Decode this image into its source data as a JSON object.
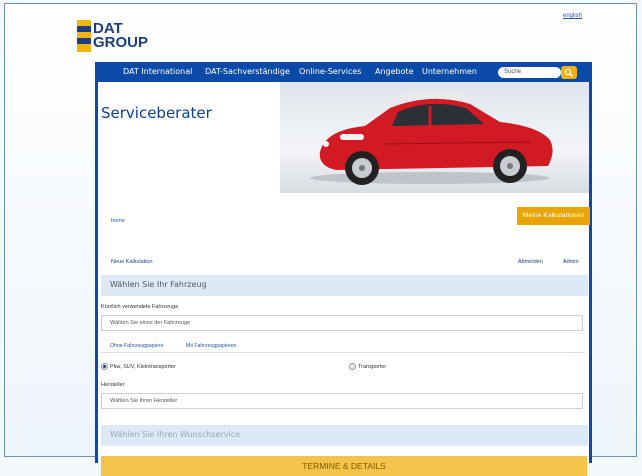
{
  "header": {
    "language_link": "english",
    "logo_line1": "DAT",
    "logo_line2": "GROUP"
  },
  "nav": {
    "items": [
      "DAT International",
      "DAT-Sachverständige",
      "Online-Services",
      "Angebote",
      "Unternehmen"
    ],
    "search_placeholder": "Suche",
    "search_icon": "magnifier-icon"
  },
  "hero": {
    "title": "Serviceberater",
    "image_desc": "red-car-image"
  },
  "links": {
    "home": "home",
    "meine_kalkulationen": "Meine Kalkulationen",
    "neue_kalkulation": "Neue Kalkulation",
    "abmelden": "Abmelden",
    "admin": "Admin"
  },
  "vehicle": {
    "section_title": "Wählen Sie Ihr Fahrzeug",
    "recent_label": "Kürzlich verwendete Fahrzeuge",
    "recent_placeholder": "Wählen Sie eines der Fahrzeuge",
    "tab_without_papers": "Ohne Fahrzeugpapiere",
    "tab_with_papers": "Mit Fahrzeugpapieren",
    "radio_car": "Pkw, SUV, Kleintransporter",
    "radio_car_selected": true,
    "radio_van": "Transporter",
    "manufacturer_label": "Hersteller",
    "manufacturer_placeholder": "Wählen Sie Ihren Hersteller"
  },
  "service": {
    "section_title": "Wählen Sie Ihren Wunschservice"
  },
  "cta": {
    "termine_label": "TERMINE & DETAILS"
  },
  "colors": {
    "nav_blue": "#0b4aa6",
    "accent_orange": "#e8a400",
    "cta_yellow": "#f4c44a",
    "band_blue": "#dde9f7"
  }
}
